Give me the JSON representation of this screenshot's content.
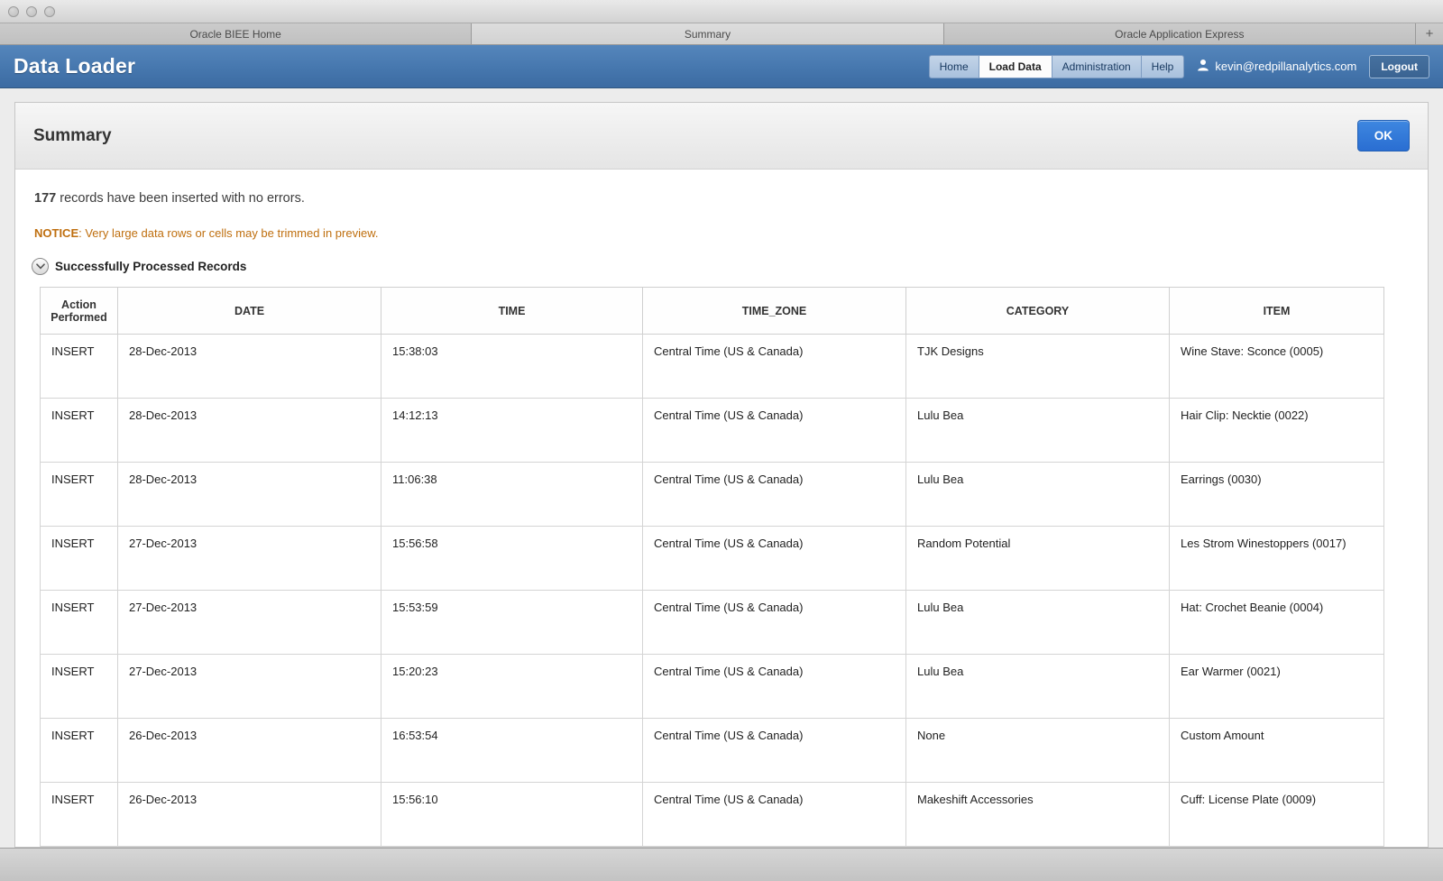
{
  "browser": {
    "tabs": [
      {
        "label": "Oracle BIEE Home",
        "active": false
      },
      {
        "label": "Summary",
        "active": true
      },
      {
        "label": "Oracle Application Express",
        "active": false
      }
    ],
    "new_tab": "+"
  },
  "header": {
    "app_title": "Data Loader",
    "nav_items": [
      {
        "label": "Home",
        "active": false
      },
      {
        "label": "Load Data",
        "active": true
      },
      {
        "label": "Administration",
        "active": false
      },
      {
        "label": "Help",
        "active": false
      }
    ],
    "user_email": "kevin@redpillanalytics.com",
    "logout": "Logout"
  },
  "summary": {
    "title": "Summary",
    "ok": "OK",
    "count": "177",
    "message": "records have been inserted with no errors.",
    "notice_label": "NOTICE",
    "notice_message": ": Very large data rows or cells may be trimmed in preview.",
    "section_title": "Successfully Processed Records"
  },
  "records_table": {
    "columns": [
      "Action Performed",
      "DATE",
      "TIME",
      "TIME_ZONE",
      "CATEGORY",
      "ITEM"
    ],
    "rows": [
      [
        "INSERT",
        "28-Dec-2013",
        "15:38:03",
        "Central Time (US & Canada)",
        "TJK Designs",
        "Wine Stave: Sconce (0005)"
      ],
      [
        "INSERT",
        "28-Dec-2013",
        "14:12:13",
        "Central Time (US & Canada)",
        "Lulu Bea",
        "Hair Clip: Necktie (0022)"
      ],
      [
        "INSERT",
        "28-Dec-2013",
        "11:06:38",
        "Central Time (US & Canada)",
        "Lulu Bea",
        "Earrings (0030)"
      ],
      [
        "INSERT",
        "27-Dec-2013",
        "15:56:58",
        "Central Time (US & Canada)",
        "Random Potential",
        "Les Strom Winestoppers (0017)"
      ],
      [
        "INSERT",
        "27-Dec-2013",
        "15:53:59",
        "Central Time (US & Canada)",
        "Lulu Bea",
        "Hat: Crochet Beanie (0004)"
      ],
      [
        "INSERT",
        "27-Dec-2013",
        "15:20:23",
        "Central Time (US & Canada)",
        "Lulu Bea",
        "Ear Warmer (0021)"
      ],
      [
        "INSERT",
        "26-Dec-2013",
        "16:53:54",
        "Central Time (US & Canada)",
        "None",
        "Custom Amount"
      ],
      [
        "INSERT",
        "26-Dec-2013",
        "15:56:10",
        "Central Time (US & Canada)",
        "Makeshift Accessories",
        "Cuff: License Plate (0009)"
      ]
    ]
  },
  "colors": {
    "header_blue": "#4677ae",
    "button_blue": "#2a6ed2",
    "notice_orange": "#bf6f0f"
  }
}
